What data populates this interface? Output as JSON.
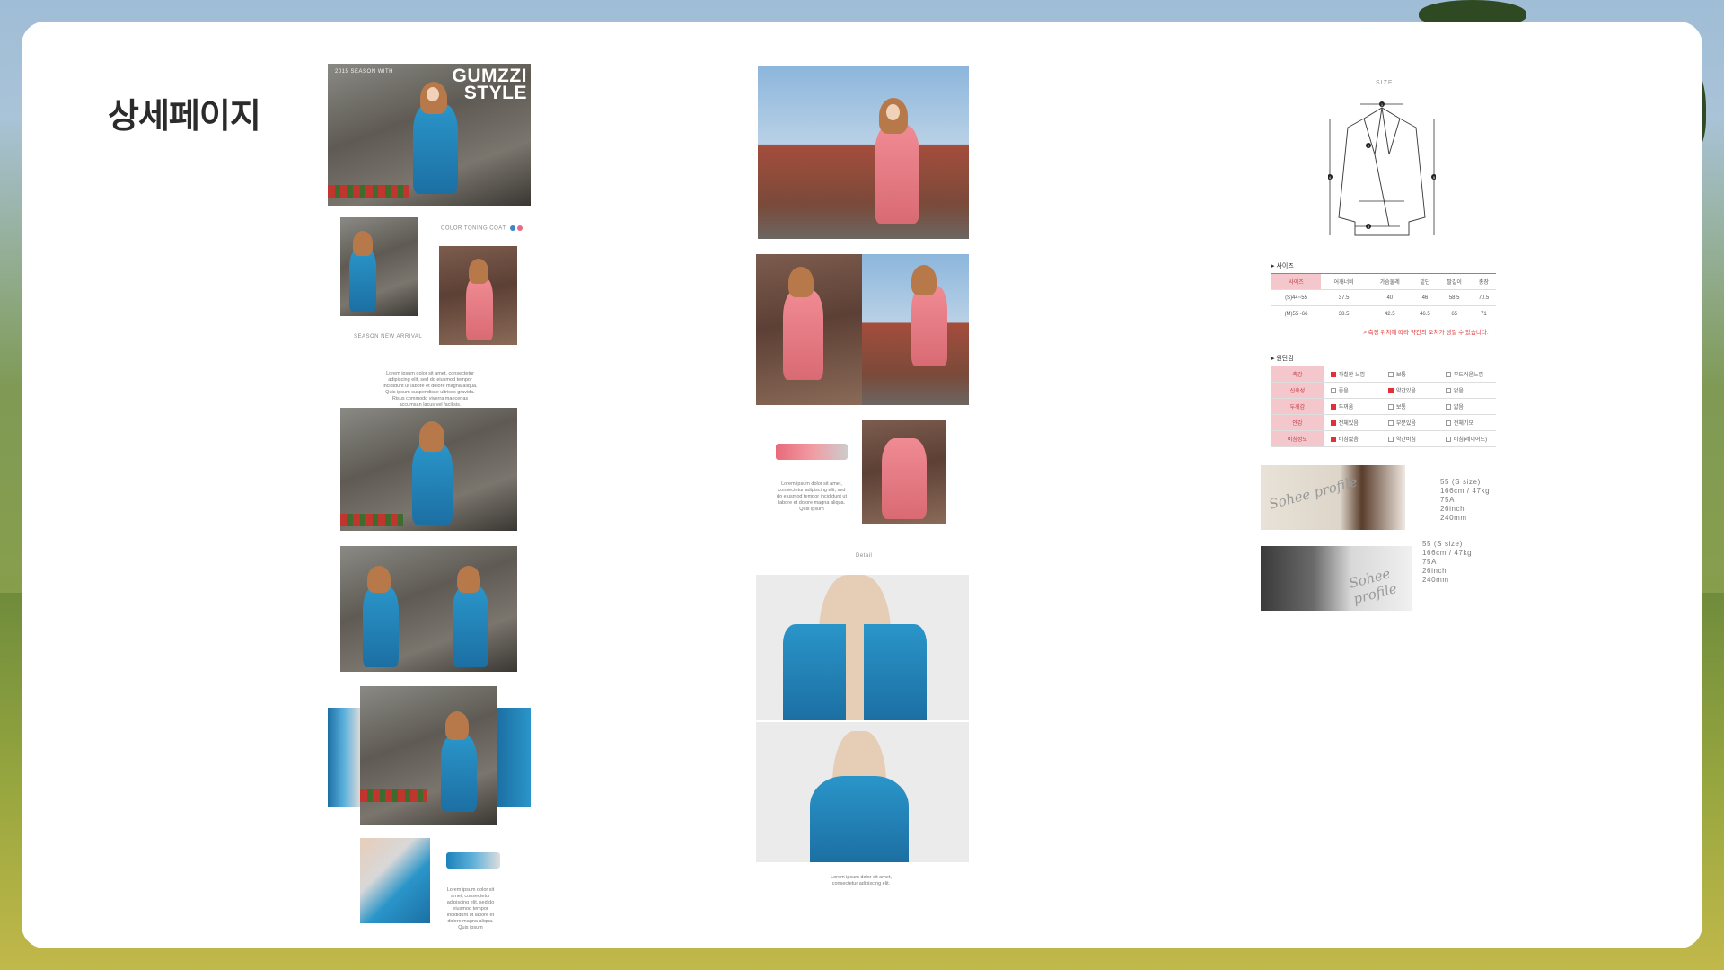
{
  "page": {
    "title": "상세페이지"
  },
  "hero": {
    "brand_line1": "GUMZZI",
    "brand_line2": "STYLE",
    "subtitle": "2015 SEASON WITH"
  },
  "left_column": {
    "color_label": "COLOR TONING COAT",
    "color_dots": [
      "#3a86c8",
      "#e86a8a"
    ],
    "season_label": "SEASON NEW ARRIVAL",
    "lorem_intro": "Lorem ipsum dolor sit amet, consectetur adipiscing elit, sed do eiusmod tempor incididunt ut labore et dolore magna aliqua. Quis ipsum suspendisse ultrices gravida. Risus commodo viverra maecenas accumsan lacus vel facilisis.",
    "lorem_bottom": "Lorem ipsum dolor sit amet, consectetur adipiscing elit, sed do eiusmod tempor incididunt ut labore et dolore magna aliqua. Quis ipsum"
  },
  "middle_column": {
    "lorem_swatch": "Lorem ipsum dolor sit amet, consectetur adipiscing elit, sed do eiusmod tempor incididunt ut labore et dolore magna aliqua. Quis ipsum",
    "detail_label": "Detail",
    "lorem_detail": "Lorem ipsum dolor sit amet, consectetur adipiscing elit."
  },
  "size_section": {
    "title": "SIZE",
    "markers": [
      "1",
      "2",
      "3",
      "4",
      "5"
    ],
    "size_table_label": "▸ 사이즈",
    "columns": [
      "사이즈",
      "어깨너비",
      "가슴둘레",
      "밑단",
      "팔길이",
      "총장"
    ],
    "rows": [
      [
        "(S)44~55",
        "37.5",
        "40",
        "46",
        "58.5",
        "70.5"
      ],
      [
        "(M)55~66",
        "38.5",
        "42.5",
        "46.5",
        "65",
        "71"
      ]
    ],
    "note": "> 측정 위치에 따라 약간의 오차가 생길 수 있습니다.",
    "fabric_label": "▸ 원단감",
    "properties": [
      {
        "label": "촉감",
        "options": [
          "까칠한 느낌",
          "보통",
          "부드러운느낌"
        ],
        "selected": 0
      },
      {
        "label": "신축성",
        "options": [
          "좋음",
          "약간있음",
          "없음"
        ],
        "selected": 1
      },
      {
        "label": "두께감",
        "options": [
          "두꺼움",
          "보통",
          "얇음"
        ],
        "selected": 0
      },
      {
        "label": "안감",
        "options": [
          "전체있음",
          "부분있음",
          "전체기모"
        ],
        "selected": 0
      },
      {
        "label": "비침정도",
        "options": [
          "비침없음",
          "약간비침",
          "비침(레이어드)"
        ],
        "selected": 0
      }
    ]
  },
  "models": [
    {
      "script": "Sohee profile",
      "line1": "55 (S size)",
      "line2": "166cm / 47kg",
      "line3": "75A",
      "line4": "26inch",
      "line5": "240mm"
    },
    {
      "script": "Sohee profile",
      "line1": "55 (S size)",
      "line2": "166cm / 47kg",
      "line3": "75A",
      "line4": "26inch",
      "line5": "240mm"
    }
  ]
}
